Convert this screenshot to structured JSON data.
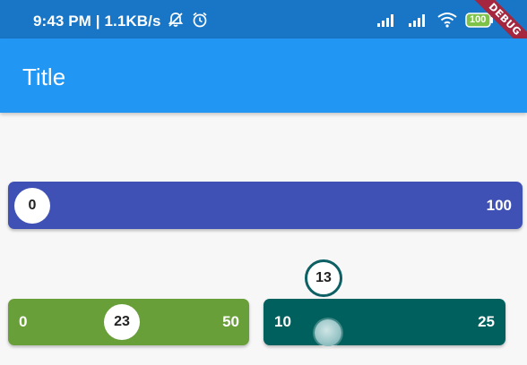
{
  "status_bar": {
    "text": "9:43 PM | 1.1KB/s",
    "battery": "100",
    "icons": [
      "notification-muted-icon",
      "alarm-icon",
      "signal-icon",
      "signal-icon",
      "wifi-icon",
      "battery-icon"
    ]
  },
  "debug_banner": "DEBUG",
  "app_bar": {
    "title": "Title"
  },
  "sliders": [
    {
      "min_label": "0",
      "max_label": "100",
      "value": "0",
      "value_fraction": 0.0,
      "color": "#3f51b5"
    },
    {
      "min_label": "0",
      "max_label": "50",
      "value": "23",
      "value_fraction": 0.46,
      "color": "#689f38"
    },
    {
      "min_label": "10",
      "max_label": "25",
      "value": "13",
      "value_fraction": 0.2,
      "color": "#00605e"
    }
  ],
  "colors": {
    "status_bar": "#1976c6",
    "app_bar": "#2196f3",
    "background": "#f7f7f7"
  }
}
